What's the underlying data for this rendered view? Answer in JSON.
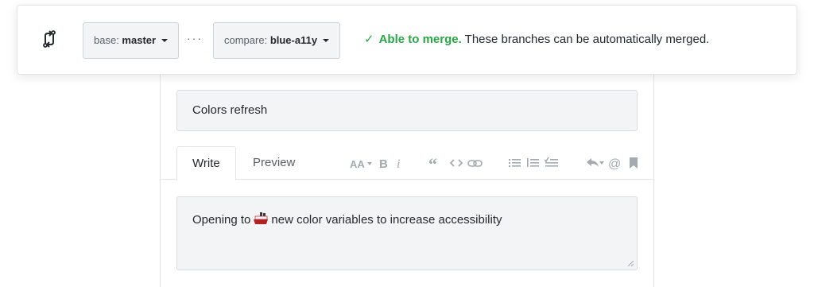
{
  "compare_bar": {
    "base_prefix": "base: ",
    "base_branch": "master",
    "ellipsis": "···",
    "compare_prefix": "compare: ",
    "compare_branch": "blue-a11y",
    "merge_check": "✓",
    "merge_status": "Able to merge.",
    "merge_description": "These branches can be automatically merged."
  },
  "form": {
    "title_value": "Colors refresh",
    "tabs": [
      {
        "label": "Write"
      },
      {
        "label": "Preview"
      }
    ],
    "body_before": "Opening to",
    "body_after": "new color variables to increase accessibility"
  },
  "colors": {
    "success": "#28a745",
    "toolbar_icon": "#a3aab1"
  },
  "toolbar_icons": [
    "text-size-icon",
    "bold-icon",
    "italic-icon",
    "quote-icon",
    "code-icon",
    "link-icon",
    "unordered-list-icon",
    "ordered-list-icon",
    "task-list-icon",
    "reply-icon",
    "mention-icon",
    "bookmark-icon"
  ]
}
